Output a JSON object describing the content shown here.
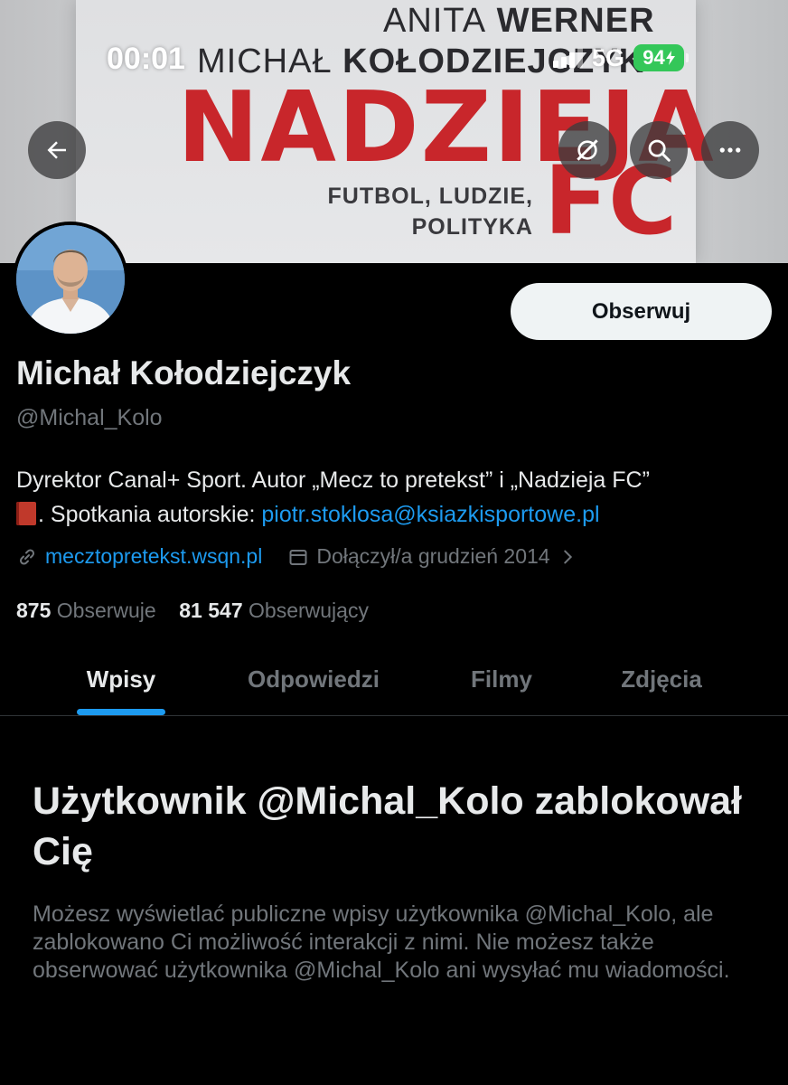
{
  "status_bar": {
    "time": "00:01",
    "network": "5G",
    "battery": "94"
  },
  "banner": {
    "author1_first": "ANITA",
    "author1_last": "WERNER",
    "author2_first": "MICHAŁ",
    "author2_last": "KOŁODZIEJCZYK",
    "book_title": "NADZIEJA",
    "book_title_fc": "FC",
    "book_subtitle_line1": "FUTBOL, LUDZIE,",
    "book_subtitle_line2": "POLITYKA"
  },
  "header_buttons": {
    "back_icon": "arrow-left-icon",
    "grok_icon": "grok-icon",
    "search_icon": "search-icon",
    "more_icon": "more-icon"
  },
  "profile": {
    "follow_label": "Obserwuj",
    "display_name": "Michał Kołodziejczyk",
    "handle": "@Michal_Kolo",
    "bio_line1": "Dyrektor Canal+ Sport. Autor „Mecz to pretekst” i „Nadzieja FC”",
    "bio_line2_prefix": ". Spotkania autorskie: ",
    "bio_email": "piotr.stoklosa@ksiazkisportowe.pl",
    "website": "mecztopretekst.wsqn.pl",
    "joined": "Dołączył/a grudzień 2014",
    "following_count": "875",
    "following_label": "Obserwuje",
    "followers_count": "81 547",
    "followers_label": "Obserwujący"
  },
  "tabs": [
    {
      "label": "Wpisy",
      "active": true
    },
    {
      "label": "Odpowiedzi",
      "active": false
    },
    {
      "label": "Filmy",
      "active": false
    },
    {
      "label": "Zdjęcia",
      "active": false
    }
  ],
  "blocked": {
    "title": "Użytkownik @Michal_Kolo zablokował Cię",
    "body": "Możesz wyświetlać publiczne wpisy użytkownika @Michal_Kolo, ale zablokowano Ci możliwość interakcji z nimi. Nie możesz także obserwować użytkownika @Michal_Kolo ani wysyłać mu wiadomości."
  },
  "colors": {
    "accent": "#1d9bf0",
    "background": "#000000",
    "secondary_text": "#71767b",
    "book_red": "#c8262b",
    "battery_green": "#34c759"
  }
}
